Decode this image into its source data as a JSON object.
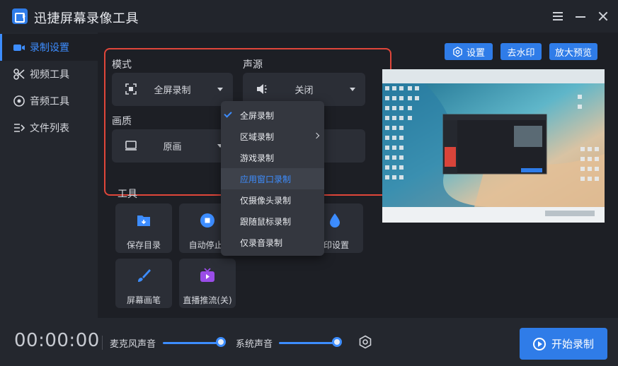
{
  "app": {
    "title": "迅捷屏幕录像工具",
    "accent_color": "#2f7ce8",
    "highlight_color": "#e0463a"
  },
  "sidebar": {
    "items": [
      {
        "label": "录制设置",
        "icon": "record-icon",
        "active": true
      },
      {
        "label": "视频工具",
        "icon": "video-tools-icon",
        "active": false
      },
      {
        "label": "音频工具",
        "icon": "audio-tools-icon",
        "active": false
      },
      {
        "label": "文件列表",
        "icon": "file-list-icon",
        "active": false
      }
    ]
  },
  "settings": {
    "mode_label": "模式",
    "mode_value": "全屏录制",
    "source_label": "声源",
    "source_value": "关闭",
    "quality_label": "画质",
    "quality_value": "原画",
    "format_value": ""
  },
  "top_buttons": {
    "settings": "设置",
    "watermark": "去水印",
    "zoom_preview": "放大预览"
  },
  "tools": {
    "label": "工具",
    "items": [
      {
        "label": "保存目录",
        "icon": "folder-icon"
      },
      {
        "label": "自动停止(",
        "icon": "auto-stop-icon"
      },
      {
        "label": "水印设置",
        "icon": "watermark-icon"
      },
      {
        "label": "屏幕画笔",
        "icon": "brush-icon"
      },
      {
        "label": "直播推流(关)",
        "icon": "live-stream-icon"
      }
    ]
  },
  "mode_dropdown": {
    "items": [
      {
        "label": "全屏录制",
        "checked": true,
        "submenu": false,
        "hover": false
      },
      {
        "label": "区域录制",
        "checked": false,
        "submenu": true,
        "hover": false
      },
      {
        "label": "游戏录制",
        "checked": false,
        "submenu": false,
        "hover": false
      },
      {
        "label": "应用窗口录制",
        "checked": false,
        "submenu": false,
        "hover": true
      },
      {
        "label": "仅摄像头录制",
        "checked": false,
        "submenu": false,
        "hover": false
      },
      {
        "label": "跟随鼠标录制",
        "checked": false,
        "submenu": false,
        "hover": false
      },
      {
        "label": "仅录音录制",
        "checked": false,
        "submenu": false,
        "hover": false
      }
    ]
  },
  "bottom": {
    "timer": "00:00:00",
    "mic_label": "麦克风声音",
    "mic_level": 1.0,
    "system_label": "系统声音",
    "system_level": 1.0,
    "start_label": "开始录制"
  }
}
